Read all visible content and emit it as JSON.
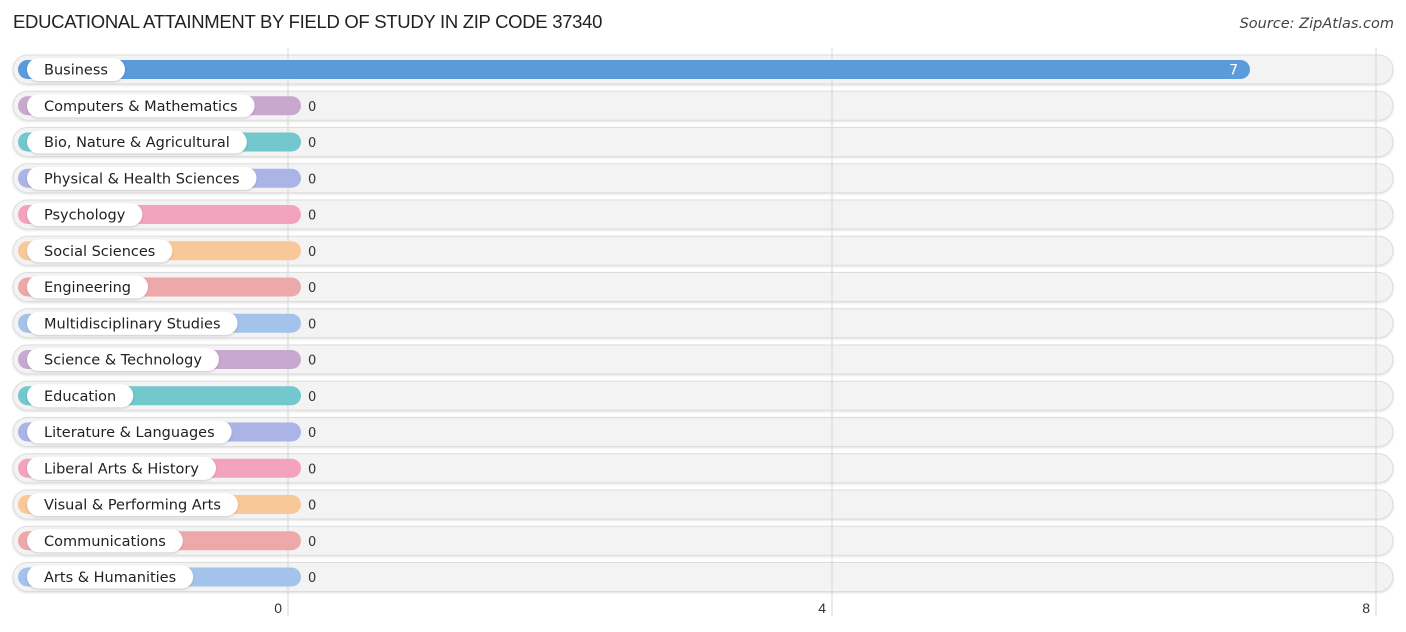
{
  "title": "EDUCATIONAL ATTAINMENT BY FIELD OF STUDY IN ZIP CODE 37340",
  "source": "Source: ZipAtlas.com",
  "chart_data": {
    "type": "bar",
    "orientation": "horizontal",
    "title": "EDUCATIONAL ATTAINMENT BY FIELD OF STUDY IN ZIP CODE 37340",
    "xlabel": "",
    "ylabel": "",
    "xlim": [
      0,
      8
    ],
    "xticks": [
      0,
      4,
      8
    ],
    "grid": true,
    "categories": [
      "Business",
      "Computers & Mathematics",
      "Bio, Nature & Agricultural",
      "Physical & Health Sciences",
      "Psychology",
      "Social Sciences",
      "Engineering",
      "Multidisciplinary Studies",
      "Science & Technology",
      "Education",
      "Literature & Languages",
      "Liberal Arts & History",
      "Visual & Performing Arts",
      "Communications",
      "Arts & Humanities"
    ],
    "values": [
      7,
      0,
      0,
      0,
      0,
      0,
      0,
      0,
      0,
      0,
      0,
      0,
      0,
      0,
      0
    ],
    "colors": [
      "#5b9bdc",
      "#c9a8cf",
      "#72c8cd",
      "#aab4e6",
      "#f4a3bf",
      "#f9c898",
      "#eda9aa",
      "#a3c3ea",
      "#c9a8cf",
      "#72c8cd",
      "#aab4e6",
      "#f4a3bf",
      "#f9c898",
      "#eda9aa",
      "#a3c3ea"
    ]
  }
}
